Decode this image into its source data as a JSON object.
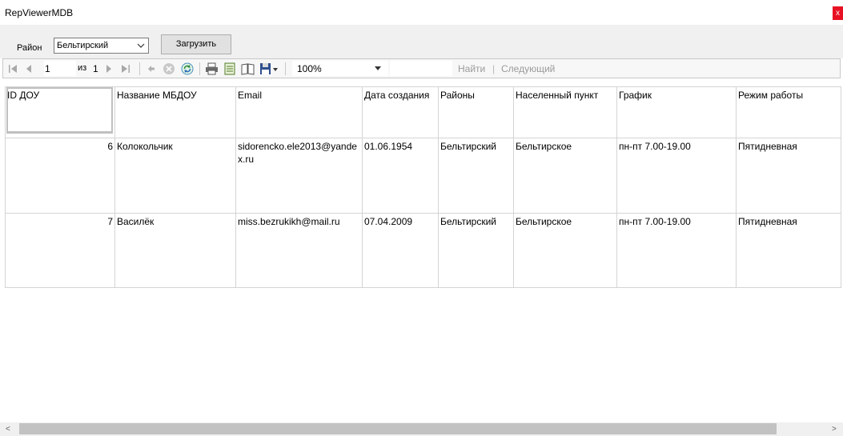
{
  "window": {
    "title": "RepViewerMDB",
    "close_label": "x"
  },
  "filter": {
    "rayon_label": "Район",
    "rayon_selected": "Бельтирский",
    "load_label": "Загрузить"
  },
  "toolbar": {
    "page_current": "1",
    "page_of_label": "из",
    "page_total": "1",
    "zoom": "100%",
    "find_label": "Найти",
    "find_separator": "|",
    "next_label": "Следующий"
  },
  "table": {
    "columns": [
      "ID ДОУ",
      "Название МБДОУ",
      "Email",
      "Дата создания",
      "Районы",
      "Населенный пункт",
      "График",
      "Режим работы"
    ],
    "rows": [
      {
        "id": "6",
        "name": "Колокольчик",
        "email": "sidorencko.ele2013@yandex.ru",
        "created": "01.06.1954",
        "district": "Бельтирский",
        "settlement": "Бельтирское",
        "schedule": "пн-пт 7.00-19.00",
        "mode": "Пятидневная"
      },
      {
        "id": "7",
        "name": "Василёк",
        "email": "miss.bezrukikh@mail.ru",
        "created": "07.04.2009",
        "district": "Бельтирский",
        "settlement": "Бельтирское",
        "schedule": "пн-пт 7.00-19.00",
        "mode": "Пятидневная"
      }
    ]
  },
  "scrollbar": {
    "left_arrow": "<",
    "right_arrow": ">"
  }
}
